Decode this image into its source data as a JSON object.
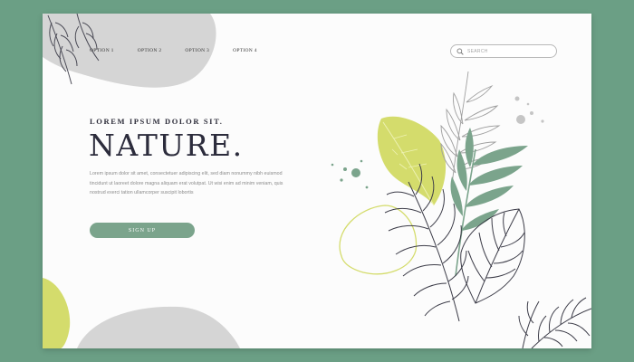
{
  "nav": {
    "links": [
      {
        "label": "OPTION 1"
      },
      {
        "label": "OPTION 2"
      },
      {
        "label": "OPTION 3"
      },
      {
        "label": "OPTION 4"
      }
    ]
  },
  "search": {
    "placeholder": "SEARCH",
    "icon": "search-icon"
  },
  "hero": {
    "eyebrow": "LOREM IPSUM DOLOR SIT.",
    "title": "NATURE.",
    "body": "Lorem ipsum dolor sit amet, consectetuer adipiscing elit, sed diam nonummy nibh euismod tincidunt ut laoreet dolore magna aliquam erat volutpat. Ut wisi enim ad minim veniam, quis nostrud exerci tation ullamcorper suscipit lobortis",
    "cta_label": "SIGN UP"
  },
  "colors": {
    "background": "#6b9f85",
    "page": "#fcfcfc",
    "accent_green": "#7ba48c",
    "leaf_lime": "#d4dc6c",
    "blob_gray": "#d5d5d5",
    "ink": "#2c2c3c"
  },
  "decor": [
    "fern-icon",
    "leaf-icon",
    "monstera-icon",
    "palm-icon"
  ]
}
